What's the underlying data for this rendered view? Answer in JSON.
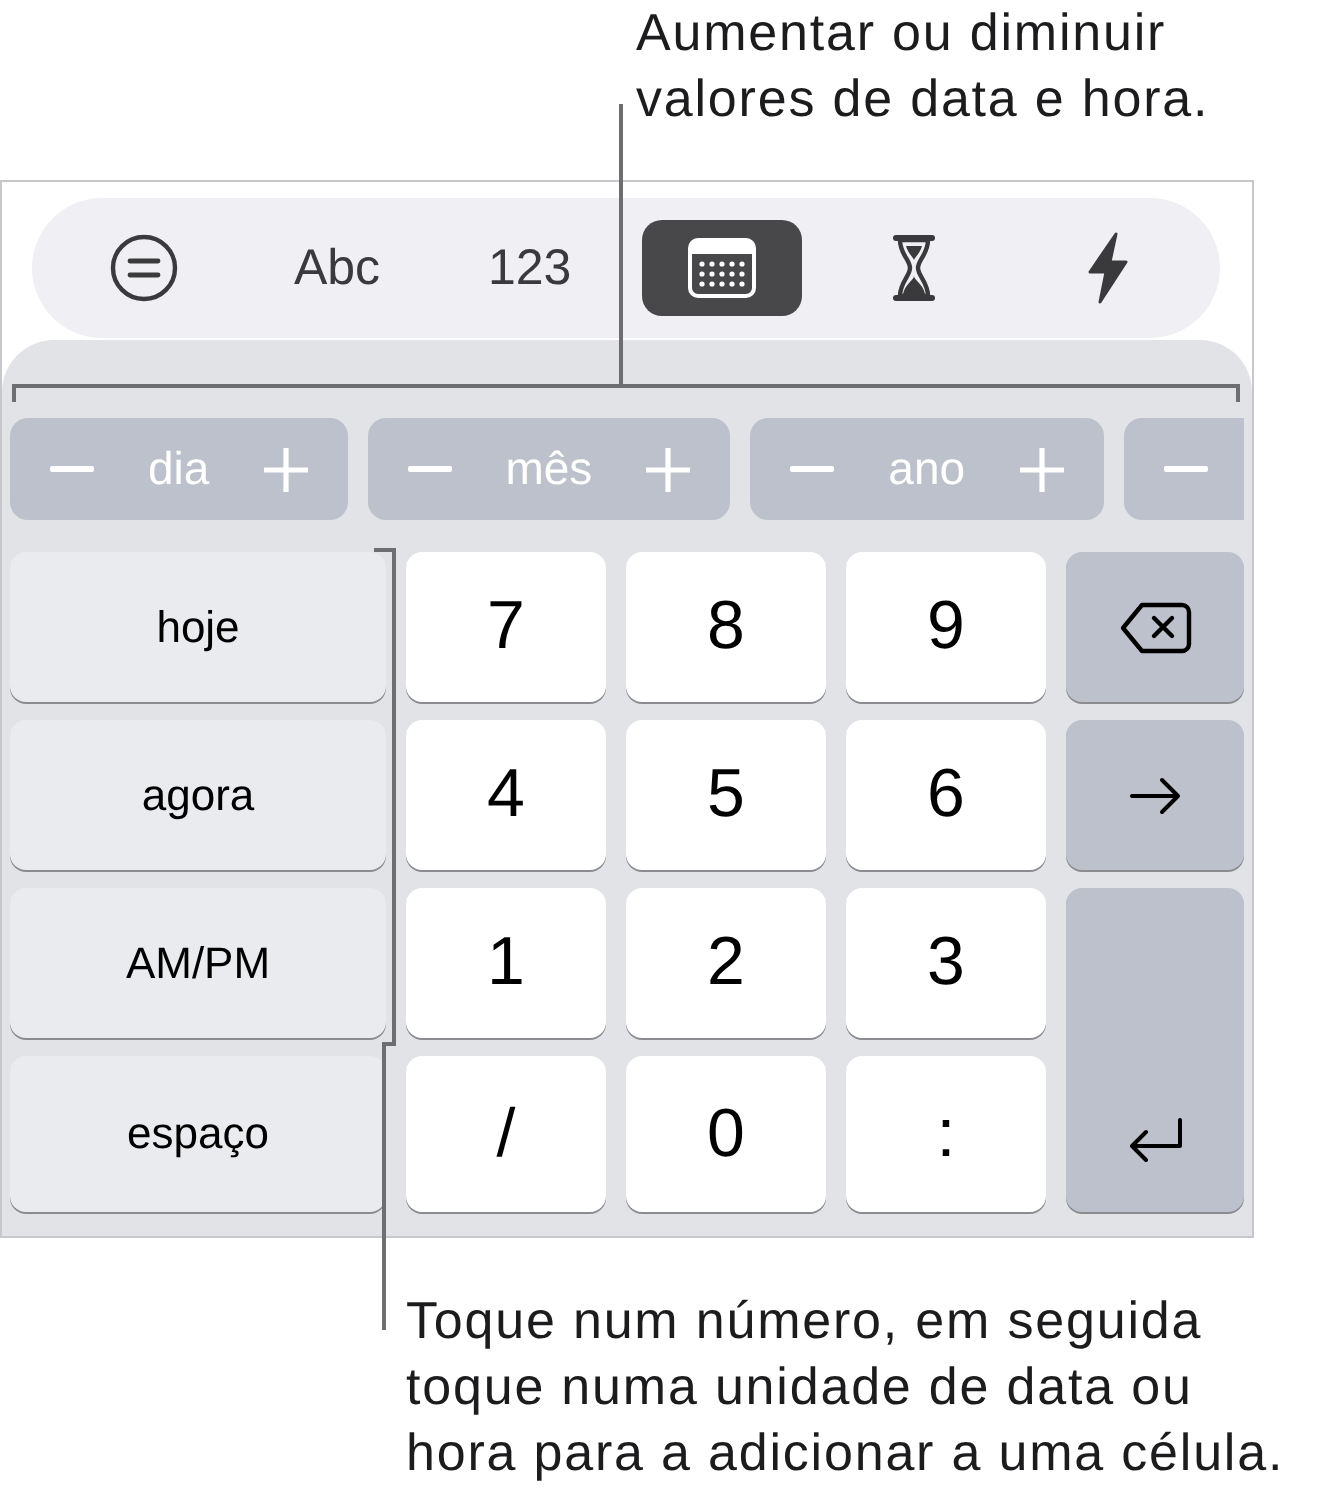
{
  "top_callout": {
    "lines": [
      "Aumentar ou diminuir",
      "valores de data e hora."
    ]
  },
  "keyboard": {
    "toolbar": [
      {
        "kind": "format",
        "selected": false
      },
      {
        "kind": "text",
        "label": "Abc",
        "selected": false
      },
      {
        "kind": "text",
        "label": "123",
        "selected": false
      },
      {
        "kind": "calendar",
        "selected": true
      },
      {
        "kind": "hourglass",
        "selected": false
      },
      {
        "kind": "lightning",
        "selected": false
      }
    ],
    "steppers": [
      {
        "kind": "full",
        "label": "dia"
      },
      {
        "kind": "full",
        "label": "mês"
      },
      {
        "kind": "full",
        "label": "ano"
      },
      {
        "kind": "clipped"
      }
    ],
    "keys": [
      {
        "kind": "function",
        "label": "hoje"
      },
      {
        "kind": "character",
        "label": "7"
      },
      {
        "kind": "character",
        "label": "8"
      },
      {
        "kind": "character",
        "label": "9"
      },
      {
        "kind": "delete"
      },
      {
        "kind": "function",
        "label": "agora"
      },
      {
        "kind": "character",
        "label": "4"
      },
      {
        "kind": "character",
        "label": "5"
      },
      {
        "kind": "character",
        "label": "6"
      },
      {
        "kind": "next"
      },
      {
        "kind": "function",
        "label": "AM/PM"
      },
      {
        "kind": "character",
        "label": "1"
      },
      {
        "kind": "character",
        "label": "2"
      },
      {
        "kind": "character",
        "label": "3"
      },
      {
        "kind": "return"
      },
      {
        "kind": "function",
        "label": "espaço"
      },
      {
        "kind": "character",
        "label": "/"
      },
      {
        "kind": "character",
        "label": "0"
      },
      {
        "kind": "character",
        "label": ":"
      }
    ]
  },
  "bottom_callout": {
    "lines": [
      "Toque num número, em seguida",
      "toque numa unidade de data ou",
      "hora para a adicionar a uma célula."
    ]
  }
}
